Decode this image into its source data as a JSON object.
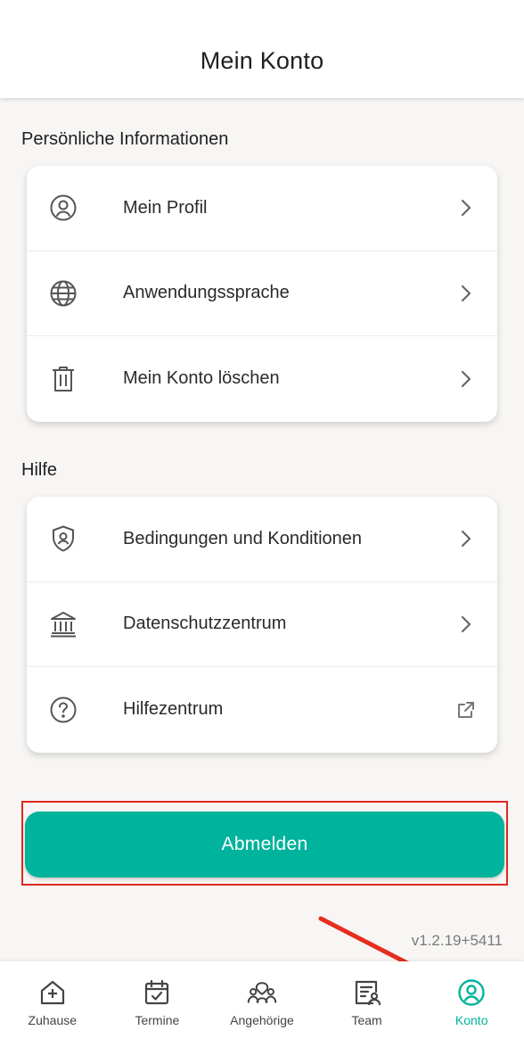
{
  "header": {
    "title": "Mein Konto"
  },
  "personal": {
    "title": "Persönliche Informationen",
    "items": [
      {
        "label": "Mein Profil",
        "icon": "user-circle-icon",
        "trail": "chevron-right-icon"
      },
      {
        "label": "Anwendungssprache",
        "icon": "globe-icon",
        "trail": "chevron-right-icon"
      },
      {
        "label": "Mein Konto löschen",
        "icon": "trash-icon",
        "trail": "chevron-right-icon"
      }
    ]
  },
  "help": {
    "title": "Hilfe",
    "items": [
      {
        "label": "Bedingungen und Konditionen",
        "icon": "shield-user-icon",
        "trail": "chevron-right-icon"
      },
      {
        "label": "Datenschutzzentrum",
        "icon": "bank-building-icon",
        "trail": "chevron-right-icon"
      },
      {
        "label": "Hilfezentrum",
        "icon": "question-circle-icon",
        "trail": "external-link-icon"
      }
    ]
  },
  "logout": {
    "label": "Abmelden"
  },
  "version": "v1.2.19+5411",
  "tabs": [
    {
      "label": "Zuhause",
      "icon": "home-plus-icon",
      "active": false
    },
    {
      "label": "Termine",
      "icon": "calendar-check-icon",
      "active": false
    },
    {
      "label": "Angehörige",
      "icon": "people-heart-icon",
      "active": false
    },
    {
      "label": "Team",
      "icon": "team-card-icon",
      "active": false
    },
    {
      "label": "Konto",
      "icon": "user-circle-icon",
      "active": true
    }
  ],
  "colors": {
    "accent": "#00b39c",
    "highlight_box": "#e0281e",
    "arrow": "#e62d1e",
    "background": "#f8f6f4",
    "icon": "#555555"
  }
}
